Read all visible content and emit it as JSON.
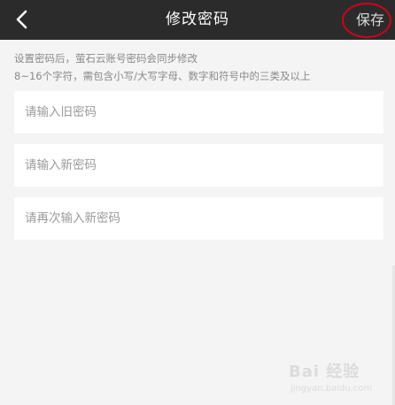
{
  "nav": {
    "title": "修改密码",
    "save_label": "保存"
  },
  "hint": {
    "line1": "设置密码后，萤石云账号密码会同步修改",
    "line2": "8~16个字符，需包含小写/大写字母、数字和符号中的三类及以上"
  },
  "fields": {
    "old_password_placeholder": "请输入旧密码",
    "new_password_placeholder": "请输入新密码",
    "confirm_password_placeholder": "请再次输入新密码"
  },
  "watermark": {
    "brand": "Bai 经验",
    "site": "jingyan.baidu.com"
  },
  "colors": {
    "nav_background": "#2b2b2b",
    "page_background": "#f4f4f4",
    "annotation_circle": "#d0021b"
  }
}
